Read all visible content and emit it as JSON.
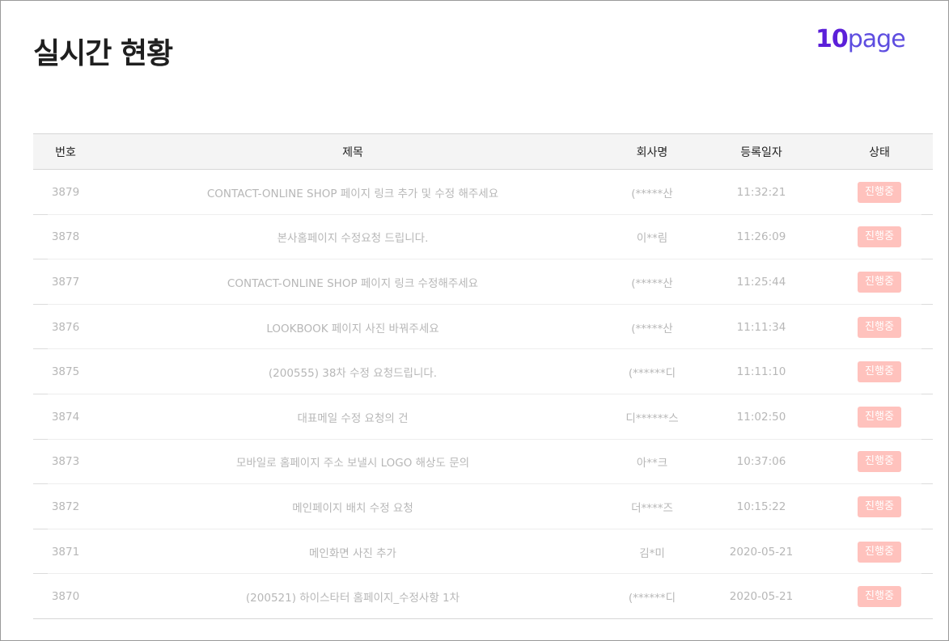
{
  "page": {
    "title": "실시간 현황",
    "logo_number": "10",
    "logo_word": "page"
  },
  "table": {
    "headers": {
      "no": "번호",
      "title": "제목",
      "company": "회사명",
      "date": "등록일자",
      "status": "상태"
    },
    "rows": [
      {
        "no": "3879",
        "title": "CONTACT-ONLINE SHOP 페이지 링크 추가 및 수정 해주세요",
        "company": "(*****산",
        "date": "11:32:21",
        "status": "진행중"
      },
      {
        "no": "3878",
        "title": "본사홈페이지 수정요청 드립니다.",
        "company": "이**림",
        "date": "11:26:09",
        "status": "진행중"
      },
      {
        "no": "3877",
        "title": "CONTACT-ONLINE SHOP 페이지 링크 수정해주세요",
        "company": "(*****산",
        "date": "11:25:44",
        "status": "진행중"
      },
      {
        "no": "3876",
        "title": "LOOKBOOK 페이지 사진 바꿔주세요",
        "company": "(*****산",
        "date": "11:11:34",
        "status": "진행중"
      },
      {
        "no": "3875",
        "title": "(200555) 38차 수정 요청드립니다.",
        "company": "(******디",
        "date": "11:11:10",
        "status": "진행중"
      },
      {
        "no": "3874",
        "title": "대표메일 수정 요청의 건",
        "company": "디******스",
        "date": "11:02:50",
        "status": "진행중"
      },
      {
        "no": "3873",
        "title": "모바일로 홈페이지 주소 보낼시 LOGO 해상도 문의",
        "company": "아**크",
        "date": "10:37:06",
        "status": "진행중"
      },
      {
        "no": "3872",
        "title": "메인페이지 배치 수정 요청",
        "company": "더****즈",
        "date": "10:15:22",
        "status": "진행중"
      },
      {
        "no": "3871",
        "title": "메인화면 사진 추가",
        "company": "김*미",
        "date": "2020-05-21",
        "status": "진행중"
      },
      {
        "no": "3870",
        "title": "(200521) 하이스타터 홈페이지_수정사항 1차",
        "company": "(******디",
        "date": "2020-05-21",
        "status": "진행중"
      }
    ]
  },
  "colors": {
    "logo_number": "#5b1fd9",
    "logo_word": "#5e4de0",
    "status_badge_bg": "#ffc2bd",
    "row_text": "#b7b7b7"
  }
}
